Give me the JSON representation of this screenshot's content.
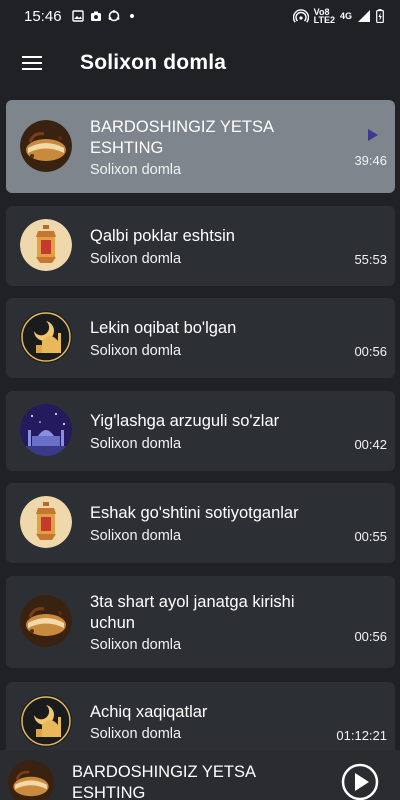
{
  "status_bar": {
    "time": "15:46",
    "icons_left": [
      "image-icon",
      "camera-icon",
      "sync-icon",
      "dot-icon"
    ],
    "icons_right": [
      "hotspot-icon",
      "volte-icon",
      "4g-icon",
      "signal-icon",
      "battery-icon"
    ],
    "network_label_1": "Vo8",
    "network_label_2": "LTE2",
    "network_label_3": "4G"
  },
  "app_bar": {
    "title": "Solixon domla",
    "menu_icon": "hamburger-menu-icon"
  },
  "tracks": [
    {
      "title": "BARDOSHINGIZ YETSA ESHTING",
      "artist": "Solixon domla",
      "duration": "39:46",
      "thumb": "quran-book",
      "active": true
    },
    {
      "title": "Qalbi poklar eshtsin",
      "artist": "Solixon domla",
      "duration": "55:53",
      "thumb": "lantern",
      "active": false
    },
    {
      "title": "Lekin oqibat bo'lgan",
      "artist": "Solixon domla",
      "duration": "00:56",
      "thumb": "mosque-moon",
      "active": false
    },
    {
      "title": "Yig'lashga arzuguli so'zlar",
      "artist": "Solixon domla",
      "duration": "00:42",
      "thumb": "mosque-night",
      "active": false
    },
    {
      "title": "Eshak go'shtini sotiyotganlar",
      "artist": "Solixon domla",
      "duration": "00:55",
      "thumb": "lantern",
      "active": false
    },
    {
      "title": "3ta shart ayol janatga kirishi uchun",
      "artist": "Solixon domla",
      "duration": "00:56",
      "thumb": "quran-book",
      "active": false
    },
    {
      "title": "Achiq xaqiqatlar",
      "artist": "Solixon domla",
      "duration": "01:12:21",
      "thumb": "mosque-moon",
      "active": false
    }
  ],
  "mini_player": {
    "title": "BARDOSHINGIZ YETSA ESHTING",
    "play_icon": "play-circle-icon"
  },
  "colors": {
    "background": "#1f2124",
    "card": "#2c2f33",
    "card_active": "#7e858c",
    "accent_play": "#3b3a8f"
  }
}
